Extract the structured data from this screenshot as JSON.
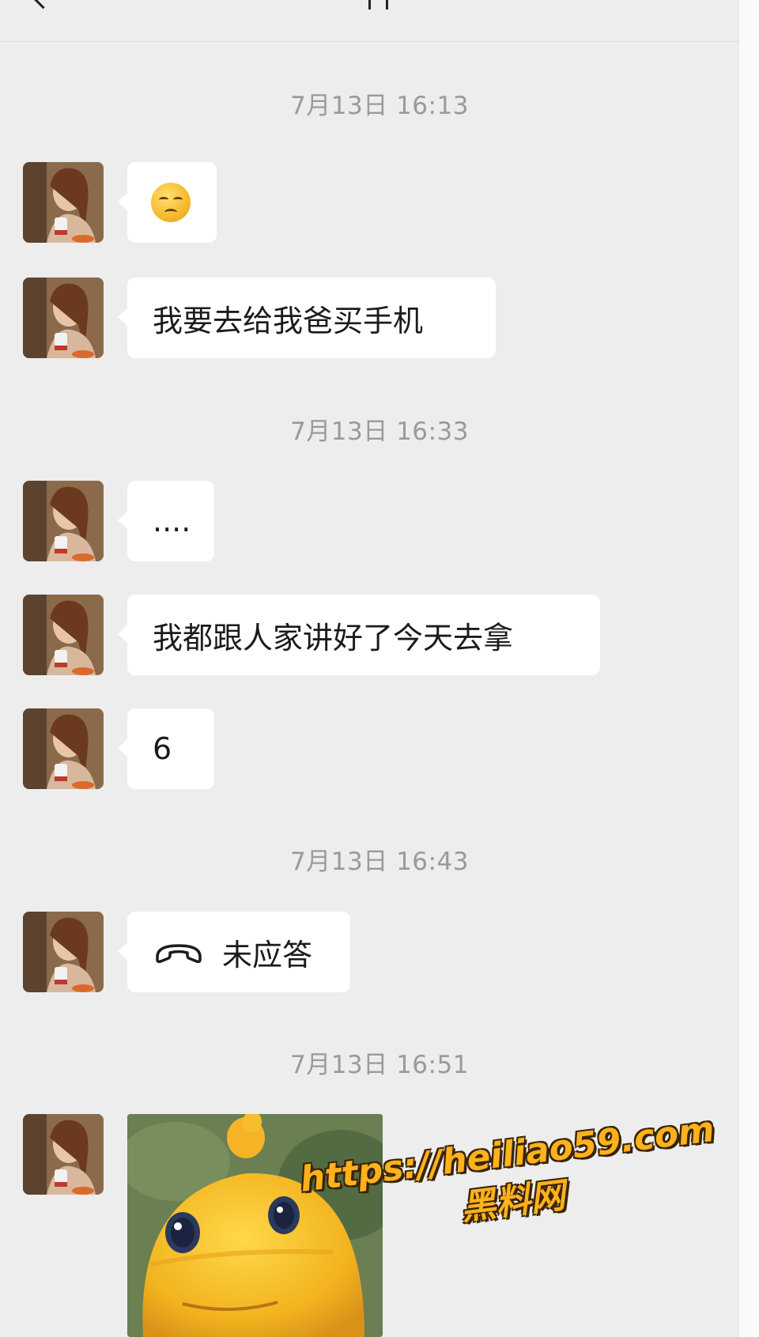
{
  "header": {
    "back_icon": "chevron-left-icon"
  },
  "messages": [
    {
      "timestamp": "7月13日 16:13"
    },
    {
      "type": "emoji",
      "emoji_name": "unamused-face-emoji"
    },
    {
      "type": "text",
      "text": "我要去给我爸买手机"
    },
    {
      "timestamp": "7月13日 16:33"
    },
    {
      "type": "text",
      "text": "...."
    },
    {
      "type": "text",
      "text": "我都跟人家讲好了今天去拿"
    },
    {
      "type": "text",
      "text": "6"
    },
    {
      "timestamp": "7月13日 16:43"
    },
    {
      "type": "call",
      "icon": "phone-hangup-icon",
      "text": "未应答"
    },
    {
      "timestamp": "7月13日 16:51"
    },
    {
      "type": "sticker",
      "sticker_name": "yellow-chick-sticker"
    }
  ],
  "watermark": {
    "url": "https://heiliao59.com",
    "name": "黑料网",
    "color": "#ffb21b"
  },
  "colors": {
    "background": "#ededed",
    "bubble": "#ffffff",
    "timestamp": "#9a9a9a"
  }
}
